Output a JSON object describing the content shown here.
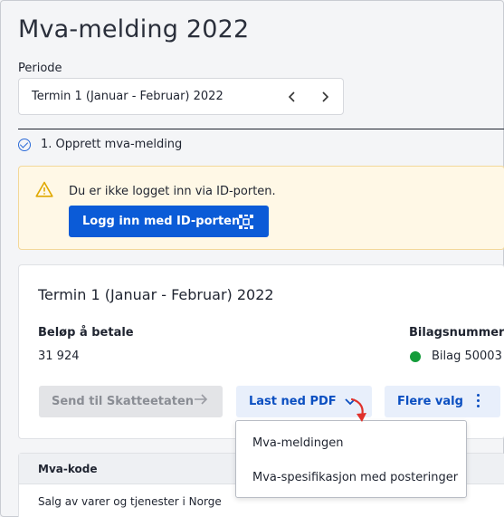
{
  "page": {
    "title": "Mva-melding 2022",
    "periode_label": "Periode",
    "periode_value": "Termin 1 (Januar - Februar) 2022"
  },
  "step": {
    "label": "1. Opprett mva-melding"
  },
  "warning": {
    "text": "Du er ikke logget inn via ID-porten.",
    "login_button": "Logg inn med ID-porten"
  },
  "card": {
    "title": "Termin 1 (Januar - Februar) 2022",
    "amount_label": "Beløp å betale",
    "amount_value": "31 924",
    "bilag_label": "Bilagsnummer",
    "bilag_value": "Bilag 50003",
    "status_color": "#149c3a"
  },
  "actions": {
    "send_label": "Send til Skatteetaten",
    "pdf_label": "Last ned PDF",
    "more_label": "Flere valg"
  },
  "dropdown": {
    "items": [
      {
        "label": "Mva-meldingen"
      },
      {
        "label": "Mva-spesifikasjon med posteringer"
      }
    ]
  },
  "table": {
    "header": "Mva-kode",
    "rows": [
      {
        "label": "Salg av varer og tjenester i Norge"
      }
    ]
  },
  "colors": {
    "primary": "#0b5bd7",
    "warning_bg": "#fff8e6",
    "accent_red": "#e0312b"
  }
}
